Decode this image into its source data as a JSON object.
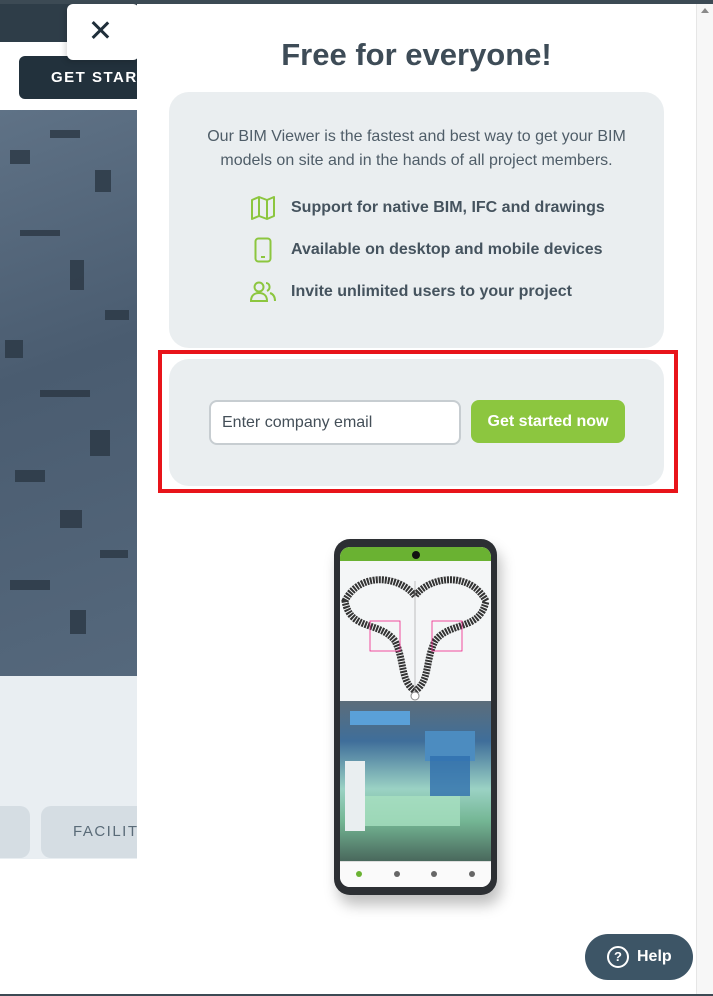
{
  "background": {
    "get_started_label": "GET STARTED",
    "category_label": "FACILITY"
  },
  "modal": {
    "title": "Free for everyone!",
    "intro": "Our BIM Viewer is the fastest and best way to get your BIM models on site and in the hands of all project members.",
    "features": [
      {
        "icon": "map-icon",
        "label": "Support for native BIM, IFC and drawings"
      },
      {
        "icon": "smartphone-icon",
        "label": "Available on desktop and mobile devices"
      },
      {
        "icon": "users-icon",
        "label": "Invite unlimited users to your project"
      }
    ],
    "email_placeholder": "Enter company email",
    "cta_label": "Get started now"
  },
  "help": {
    "label": "Help"
  },
  "colors": {
    "accent": "#8cc63f",
    "highlight": "#e8141a",
    "title": "#3e4c57"
  }
}
